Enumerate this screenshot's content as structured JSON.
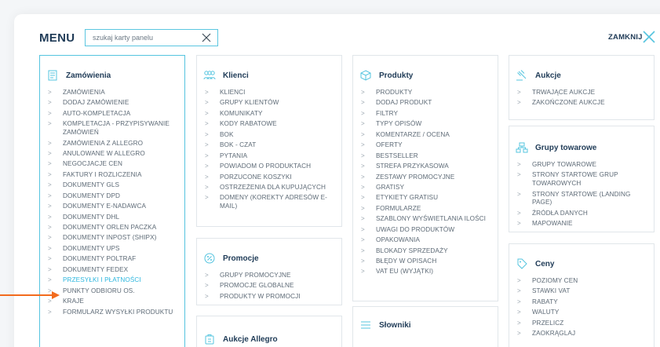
{
  "header": {
    "title": "MENU",
    "search_placeholder": "szukaj karty panelu",
    "close_label": "ZAMKNIJ"
  },
  "colors": {
    "accent": "#55c4df",
    "highlight": "#2eb7df",
    "arrow": "#f26b1d",
    "title": "#1f3b57"
  },
  "cards": {
    "zamowienia": {
      "title": "Zamówienia",
      "icon": "orders-icon",
      "items": [
        "ZAMÓWIENIA",
        "DODAJ ZAMÓWIENIE",
        "AUTO-KOMPLETACJA",
        "KOMPLETACJA - PRZYPISYWANIE\nZAMÓWIEŃ",
        "ZAMÓWIENIA Z ALLEGRO",
        "ANULOWANE W ALLEGRO",
        "NEGOCJACJE CEN",
        "FAKTURY I ROZLICZENIA",
        "DOKUMENTY GLS",
        "DOKUMENTY DPD",
        "DOKUMENTY E-NADAWCA",
        "DOKUMENTY DHL",
        "DOKUMENTY ORLEN PACZKA",
        "DOKUMENTY INPOST (SHIPX)",
        "DOKUMENTY UPS",
        "DOKUMENTY POLTRAF",
        "DOKUMENTY FEDEX",
        "PRZESYŁKI I PŁATNOŚCI",
        "PUNKTY ODBIORU OS.",
        "KRAJE",
        "FORMULARZ WYSYŁKI PRODUKTU"
      ]
    },
    "klienci": {
      "title": "Klienci",
      "icon": "users-icon",
      "items": [
        "KLIENCI",
        "GRUPY KLIENTÓW",
        "KOMUNIKATY",
        "KODY RABATOWE",
        "BOK",
        "BOK - CZAT",
        "PYTANIA",
        "POWIADOM O PRODUKTACH",
        "PORZUCONE KOSZYKI",
        "OSTRZEŻENIA DLA KUPUJĄCYCH",
        "DOMENY (KOREKTY ADRESÓW E-\nMAIL)"
      ]
    },
    "promocje": {
      "title": "Promocje",
      "icon": "percent-icon",
      "items": [
        "GRUPY PROMOCYJNE",
        "PROMOCJE GLOBALNE",
        "PRODUKTY W PROMOCJI"
      ]
    },
    "aukcje_allegro": {
      "title": "Aukcje Allegro",
      "icon": "allegro-icon"
    },
    "produkty": {
      "title": "Produkty",
      "icon": "box-icon",
      "items": [
        "PRODUKTY",
        "DODAJ PRODUKT",
        "FILTRY",
        "TYPY OPISÓW",
        "KOMENTARZE / OCENA",
        "OFERTY",
        "BESTSELLER",
        "STREFA PRZYKASOWA",
        "ZESTAWY PROMOCYJNE",
        "GRATISY",
        "ETYKIETY GRATISU",
        "FORMULARZE",
        "SZABLONY WYŚWIETLANIA ILOŚCI",
        "UWAGI DO PRODUKTÓW",
        "OPAKOWANIA",
        "BLOKADY SPRZEDAŻY",
        "BŁĘDY W OPISACH",
        "VAT EU (WYJĄTKI)"
      ]
    },
    "slowniki": {
      "title": "Słowniki",
      "icon": "list-icon"
    },
    "aukcje": {
      "title": "Aukcje",
      "icon": "gavel-icon",
      "items": [
        "TRWAJĄCE AUKCJE",
        "ZAKOŃCZONE AUKCJE"
      ]
    },
    "grupy_towarowe": {
      "title": "Grupy towarowe",
      "icon": "network-icon",
      "items": [
        "GRUPY TOWAROWE",
        "STRONY STARTOWE GRUP\nTOWAROWYCH",
        "STRONY STARTOWE (LANDING\nPAGE)",
        "ŹRÓDŁA DANYCH",
        "MAPOWANIE"
      ]
    },
    "ceny": {
      "title": "Ceny",
      "icon": "price-tag-icon",
      "items": [
        "POZIOMY CEN",
        "STAWKI VAT",
        "RABATY",
        "WALUTY",
        "PRZELICZ",
        "ZAOKRĄGLAJ"
      ]
    }
  }
}
